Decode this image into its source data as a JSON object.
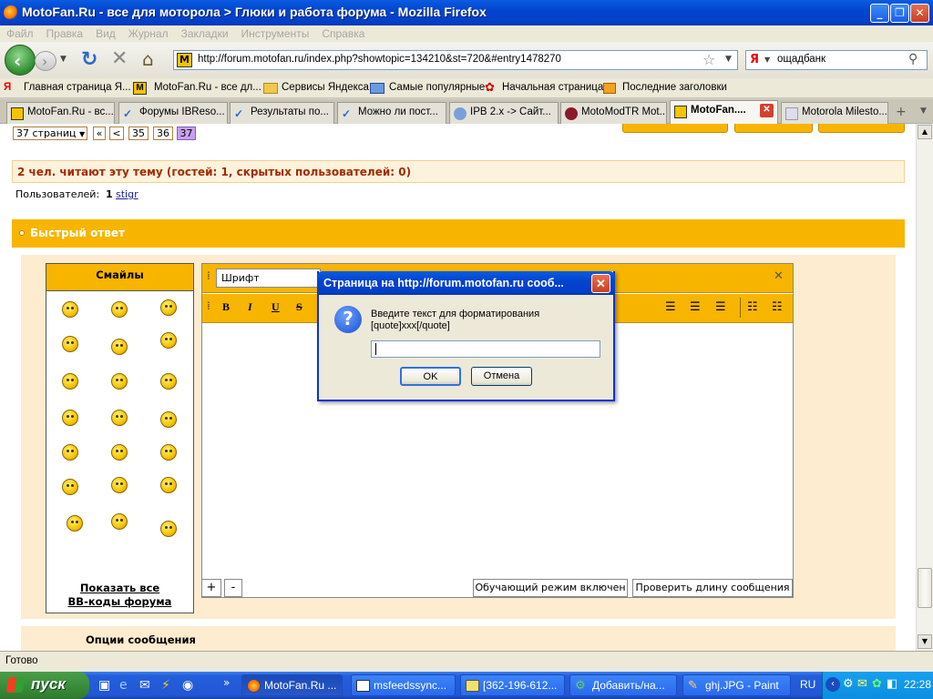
{
  "window": {
    "title": "MotoFan.Ru - все для моторола > Глюки и работа форума - Mozilla Firefox"
  },
  "menu": [
    "Файл",
    "Правка",
    "Вид",
    "Журнал",
    "Закладки",
    "Инструменты",
    "Справка"
  ],
  "nav": {
    "url": "http://forum.motofan.ru/index.php?showtopic=134210&st=720&#entry1478270",
    "search_value": "ощадбанк"
  },
  "bookmarks": [
    "Главная страница Я...",
    "MotoFan.Ru - все дл...",
    "Сервисы Яндекса",
    "Самые популярные",
    "Начальная страница",
    "Последние заголовки"
  ],
  "tabs": [
    "MotoFan.Ru - вс...",
    "Форумы IBReso...",
    "Результаты по...",
    "Можно ли пост...",
    "IPB 2.x -> Сайт...",
    "MotoModTR Mot...",
    "MotoFan....",
    "Motorola Milesto..."
  ],
  "page": {
    "pages_select": "37 страниц",
    "pager": [
      "«",
      "<",
      "35",
      "36",
      "37"
    ],
    "readers_text": "2 чел. читают эту тему (гостей: 1, скрытых пользователей: 0)",
    "users_label": "Пользователей:",
    "users_count": "1",
    "user_link": "stigr",
    "quick_reply": "Быстрый ответ",
    "smilies_title": "Смайлы",
    "show_all": "Показать все",
    "bbcodes": "BB-коды форума",
    "font_select": "Шрифт",
    "plus": "+",
    "minus": "-",
    "tutorial_btn": "Обучающий режим включен",
    "check_len_btn": "Проверить длину сообщения",
    "options_title": "Опции сообщения"
  },
  "dialog": {
    "title": "Страница на http://forum.motofan.ru сооб...",
    "message_line1": "Введите текст для форматирования",
    "message_line2": "[quote]xxx[/quote]",
    "input_value": "",
    "ok": "OK",
    "cancel": "Отмена"
  },
  "status": {
    "text": "Готово"
  },
  "taskbar": {
    "start": "пуск",
    "tasks": [
      "MotoFan.Ru ...",
      "msfeedssync...",
      "[362-196-612...",
      "Добавить/на...",
      "ghj.JPG - Paint"
    ],
    "lang": "RU",
    "clock": "22:28"
  },
  "colors": {
    "forum_orange": "#f7b500",
    "forum_bg": "#fdecd0",
    "header_red": "#a52a00",
    "xp_blue": "#0a5ce0"
  }
}
